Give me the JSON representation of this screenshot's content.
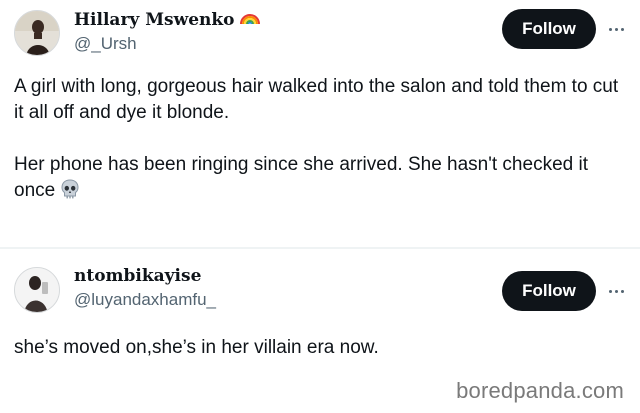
{
  "posts": [
    {
      "display_name": "Hillary Mswenko",
      "name_emoji": "rainbow-icon",
      "handle": "@_Ursh",
      "follow_label": "Follow",
      "more_icon": "more-horizontal-icon",
      "text": "A girl with long, gorgeous hair walked into the salon and told them to cut it all off and dye it blonde.\n\nHer phone has been ringing since she arrived. She hasn't checked it once",
      "trailing_emoji": "skull-icon"
    },
    {
      "display_name": "ntombikayise",
      "handle": "@luyandaxhamfu_",
      "follow_label": "Follow",
      "more_icon": "more-horizontal-icon",
      "text": "she’s moved on,she’s in her villain era now."
    }
  ],
  "watermark": "boredpanda.com",
  "colors": {
    "text_primary": "#0f1419",
    "text_secondary": "#536471",
    "button_bg": "#0f1419",
    "button_text": "#ffffff",
    "divider": "#eff3f4"
  }
}
